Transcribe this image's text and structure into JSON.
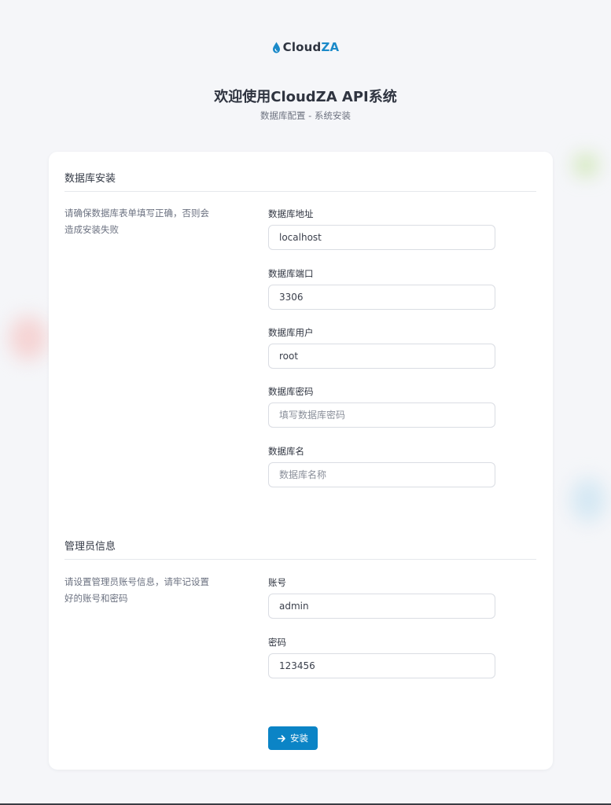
{
  "logo": {
    "part_a": "Cloud",
    "part_b": "ZA"
  },
  "header": {
    "title": "欢迎使用CloudZA API系统",
    "subtitle": "数据库配置 - 系统安装"
  },
  "database_section": {
    "title": "数据库安装",
    "description": "请确保数据库表单填写正确，否则会造成安装失败",
    "fields": [
      {
        "label": "数据库地址",
        "value": "localhost",
        "placeholder": ""
      },
      {
        "label": "数据库端口",
        "value": "3306",
        "placeholder": ""
      },
      {
        "label": "数据库用户",
        "value": "root",
        "placeholder": ""
      },
      {
        "label": "数据库密码",
        "value": "",
        "placeholder": "填写数据库密码"
      },
      {
        "label": "数据库名",
        "value": "",
        "placeholder": "数据库名称"
      }
    ]
  },
  "admin_section": {
    "title": "管理员信息",
    "description": "请设置管理员账号信息，请牢记设置好的账号和密码",
    "fields": [
      {
        "label": "账号",
        "value": "admin",
        "placeholder": ""
      },
      {
        "label": "密码",
        "value": "123456",
        "placeholder": ""
      }
    ]
  },
  "install_button": {
    "label": "安装",
    "icon": "arrow-right-icon"
  },
  "colors": {
    "accent": "#0b84c6",
    "logo_accent": "#1b8ac9",
    "background": "#f5f6f9",
    "card": "#ffffff"
  }
}
